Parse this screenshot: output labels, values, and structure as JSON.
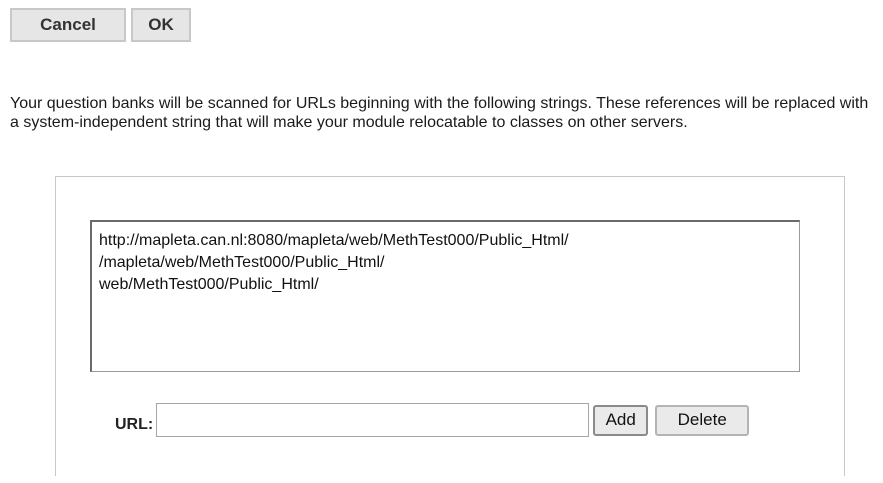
{
  "toolbar": {
    "cancel_label": "Cancel",
    "ok_label": "OK"
  },
  "description": "Your question banks will be scanned for URLs beginning with the following strings. These references will be replaced with a system-independent string that will make your module relocatable to classes on other servers.",
  "url_list": {
    "items": [
      "http://mapleta.can.nl:8080/mapleta/web/MethTest000/Public_Html/",
      "/mapleta/web/MethTest000/Public_Html/",
      "web/MethTest000/Public_Html/"
    ]
  },
  "url_form": {
    "label": "URL:",
    "value": "",
    "add_label": "Add",
    "delete_label": "Delete"
  }
}
